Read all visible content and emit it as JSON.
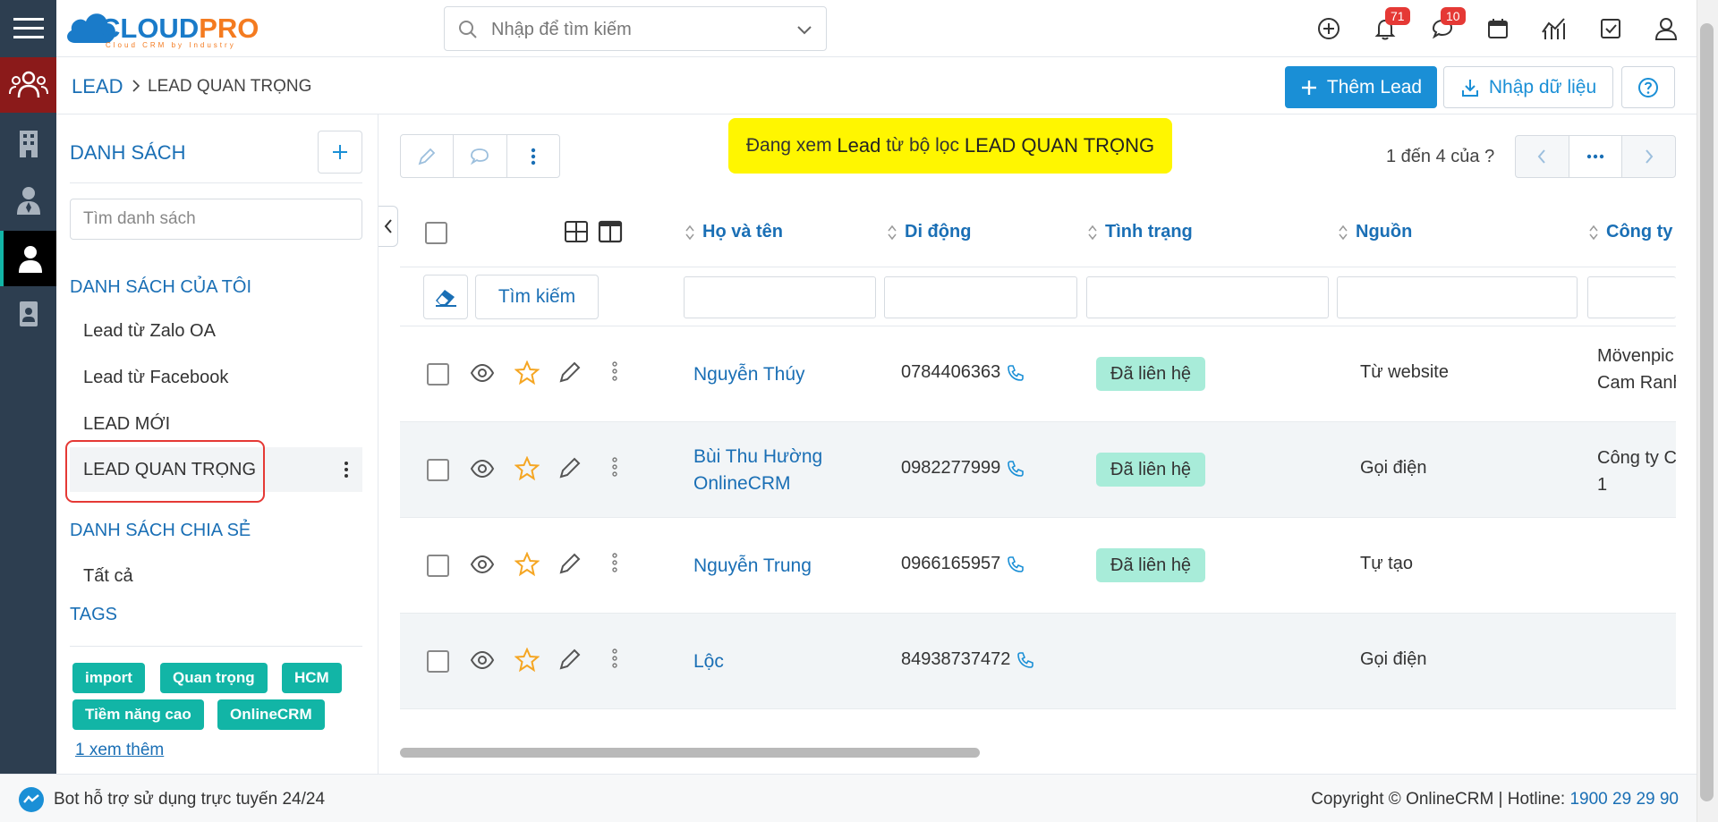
{
  "header": {
    "logo_main_1": "CLOUD",
    "logo_main_2": "PRO",
    "logo_sub": "Cloud CRM by Industry",
    "search_placeholder": "Nhập để tìm kiếm",
    "notification_count": "71",
    "message_count": "10"
  },
  "breadcrumb": {
    "root": "LEAD",
    "current": "LEAD QUAN TRỌNG"
  },
  "actions": {
    "add_lead": "Thêm Lead",
    "import": "Nhập dữ liệu"
  },
  "sidebar": {
    "title": "DANH SÁCH",
    "search_placeholder": "Tìm danh sách",
    "my_lists_title": "DANH SÁCH CỦA TÔI",
    "my_lists": [
      "Lead từ Zalo OA",
      "Lead từ Facebook",
      "LEAD MỚI",
      "LEAD QUAN TRỌNG"
    ],
    "shared_title": "DANH SÁCH CHIA SẺ",
    "shared_lists": [
      "Tất cả"
    ],
    "tags_title": "TAGS",
    "tags": [
      "import",
      "Quan trọng",
      "HCM",
      "Tiềm năng cao",
      "OnlineCRM"
    ],
    "more_link": "1  xem thêm"
  },
  "filter_note": {
    "prefix": "Đang xem",
    "module": "Lead",
    "middle": "từ bộ lọc",
    "filter": "LEAD QUAN TRỌNG"
  },
  "pager": {
    "text": "1 đến 4 của",
    "unknown": "?"
  },
  "table": {
    "columns": [
      "Họ và tên",
      "Di động",
      "Tình trạng",
      "Nguồn",
      "Công ty"
    ],
    "search_button": "Tìm kiếm",
    "rows": [
      {
        "name": "Nguyễn Thúy",
        "phone": "0784406363",
        "status": "Đã liên hệ",
        "source": "Từ website",
        "company_1": "Mövenpic",
        "company_2": "Cam Ranh"
      },
      {
        "name": "Bùi Thu Hường OnlineCRM",
        "name_1": "Bùi Thu Hường",
        "name_2": "OnlineCRM",
        "phone": "0982277999",
        "status": "Đã liên hệ",
        "source": "Gọi điện",
        "company_1": "Công ty C",
        "company_2": "1"
      },
      {
        "name": "Nguyễn Trung",
        "phone": "0966165957",
        "status": "Đã liên hệ",
        "source": "Tự tạo",
        "company_1": "",
        "company_2": ""
      },
      {
        "name": "Lộc",
        "phone": "84938737472",
        "status": "",
        "source": "Gọi điện",
        "company_1": "",
        "company_2": ""
      }
    ]
  },
  "footer": {
    "bot_text": "Bot hỗ trợ sử dụng trực tuyến 24/24",
    "copyright": "Copyright © OnlineCRM",
    "hotline_label": "Hotline:",
    "hotline": "1900 29 29 90"
  },
  "colors": {
    "rail": "#2d3e50",
    "primary": "#1a8fd6",
    "link": "#1a6fb5",
    "tag": "#12b5a6",
    "status_bg": "#a8ecd9",
    "highlight": "#fff600",
    "active_rail": "#8b1a1a"
  }
}
